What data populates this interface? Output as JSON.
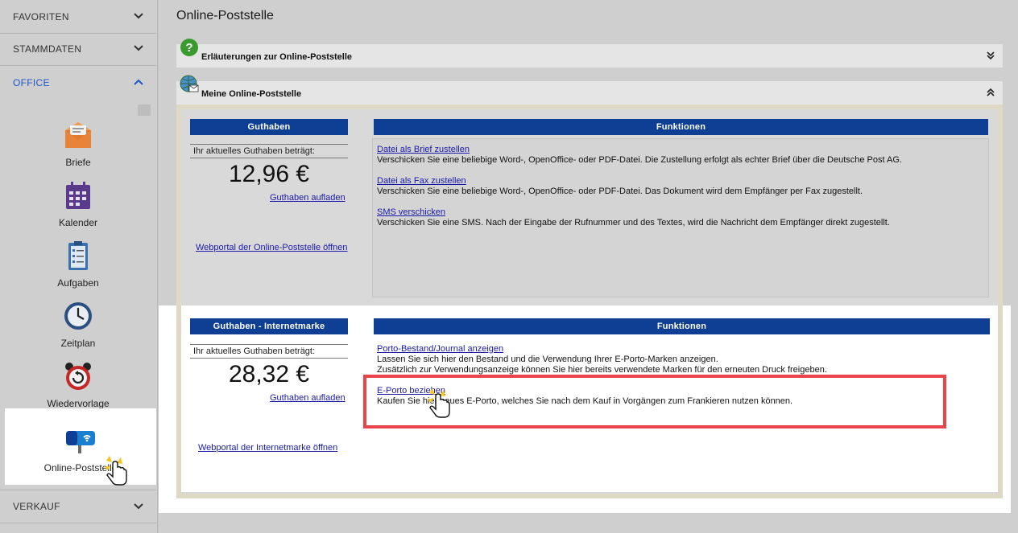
{
  "sidebar": {
    "sections": {
      "favoriten": "FAVORITEN",
      "stammdaten": "STAMMDATEN",
      "office": "OFFICE",
      "verkauf": "VERKAUF"
    },
    "items": [
      {
        "label": "Briefe",
        "icon": "envelope-icon"
      },
      {
        "label": "Kalender",
        "icon": "calendar-icon"
      },
      {
        "label": "Aufgaben",
        "icon": "clipboard-icon"
      },
      {
        "label": "Zeitplan",
        "icon": "clock-icon"
      },
      {
        "label": "Wiedervorlage",
        "icon": "alarm-clock-icon"
      },
      {
        "label": "Online-Poststelle",
        "icon": "mailbox-icon"
      }
    ]
  },
  "main": {
    "title": "Online-Poststelle",
    "accordion_help": "Erläuterungen zur Online-Poststelle",
    "accordion_mine": "Meine Online-Poststelle",
    "section1": {
      "bar_left": "Guthaben",
      "bar_right": "Funktionen",
      "balance_label": "Ihr aktuelles Guthaben beträgt:",
      "balance": "12,96 €",
      "topup_link": "Guthaben aufladen",
      "portal_link": "Webportal der Online-Poststelle öffnen",
      "functions": [
        {
          "link": "Datei als Brief zustellen",
          "desc": "Verschicken Sie eine beliebige Word-, OpenOffice- oder PDF-Datei. Die Zustellung erfolgt als echter Brief über die Deutsche Post AG."
        },
        {
          "link": "Datei als Fax zustellen",
          "desc": "Verschicken Sie eine beliebige Word-, OpenOffice- oder PDF-Datei. Das Dokument wird dem Empfänger per Fax zugestellt."
        },
        {
          "link": "SMS verschicken",
          "desc": "Verschicken Sie eine SMS. Nach der Eingabe der Rufnummer und des Textes, wird die Nachricht dem Empfänger direkt zugestellt."
        }
      ]
    },
    "section2": {
      "bar_left": "Guthaben - Internetmarke",
      "bar_right": "Funktionen",
      "balance_label": "Ihr aktuelles Guthaben beträgt:",
      "balance": "28,32 €",
      "topup_link": "Guthaben aufladen",
      "portal_link": "Webportal der Internetmarke öffnen",
      "functions": [
        {
          "link": "Porto-Bestand/Journal anzeigen",
          "desc": "Lassen Sie sich hier den Bestand und die Verwendung Ihrer E-Porto-Marken anzeigen.",
          "desc2": "Zusätzlich zur Verwendungsanzeige können Sie hier bereits verwendete Marken für den erneuten Druck freigeben."
        },
        {
          "link": "E-Porto beziehen",
          "desc": "Kaufen Sie hier neues E-Porto, welches Sie nach dem Kauf in Vorgängen zum Frankieren nutzen können."
        }
      ]
    }
  },
  "colors": {
    "accent_blue": "#0e3f94",
    "link_blue": "#1a1aa8",
    "highlight_red": "#e8444a",
    "office_blue": "#1e56c8"
  }
}
